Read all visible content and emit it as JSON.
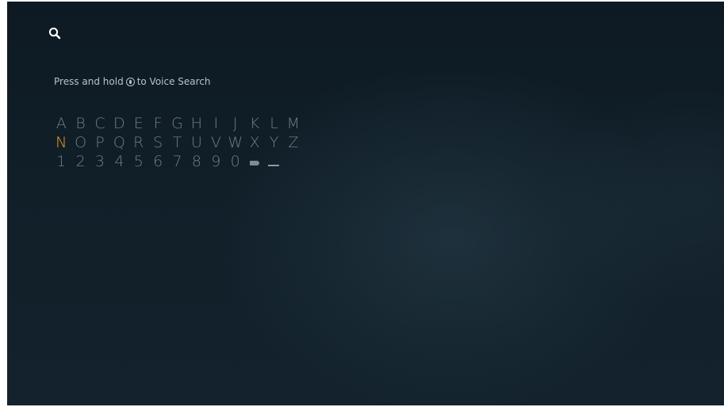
{
  "header": {
    "search_icon": "search-icon"
  },
  "voice_hint": {
    "before": "Press and hold",
    "mic_icon": "microphone-icon",
    "after": "to Voice Search"
  },
  "keyboard": {
    "selected_key": "N",
    "accent_color": "#f0a020",
    "row1": [
      "A",
      "B",
      "C",
      "D",
      "E",
      "F",
      "G",
      "H",
      "I",
      "J",
      "K",
      "L",
      "M"
    ],
    "row2": [
      "N",
      "O",
      "P",
      "Q",
      "R",
      "S",
      "T",
      "U",
      "V",
      "W",
      "X",
      "Y",
      "Z"
    ],
    "row3": [
      "1",
      "2",
      "3",
      "4",
      "5",
      "6",
      "7",
      "8",
      "9",
      "0"
    ],
    "special_keys": [
      "backspace-icon",
      "space-icon"
    ]
  }
}
